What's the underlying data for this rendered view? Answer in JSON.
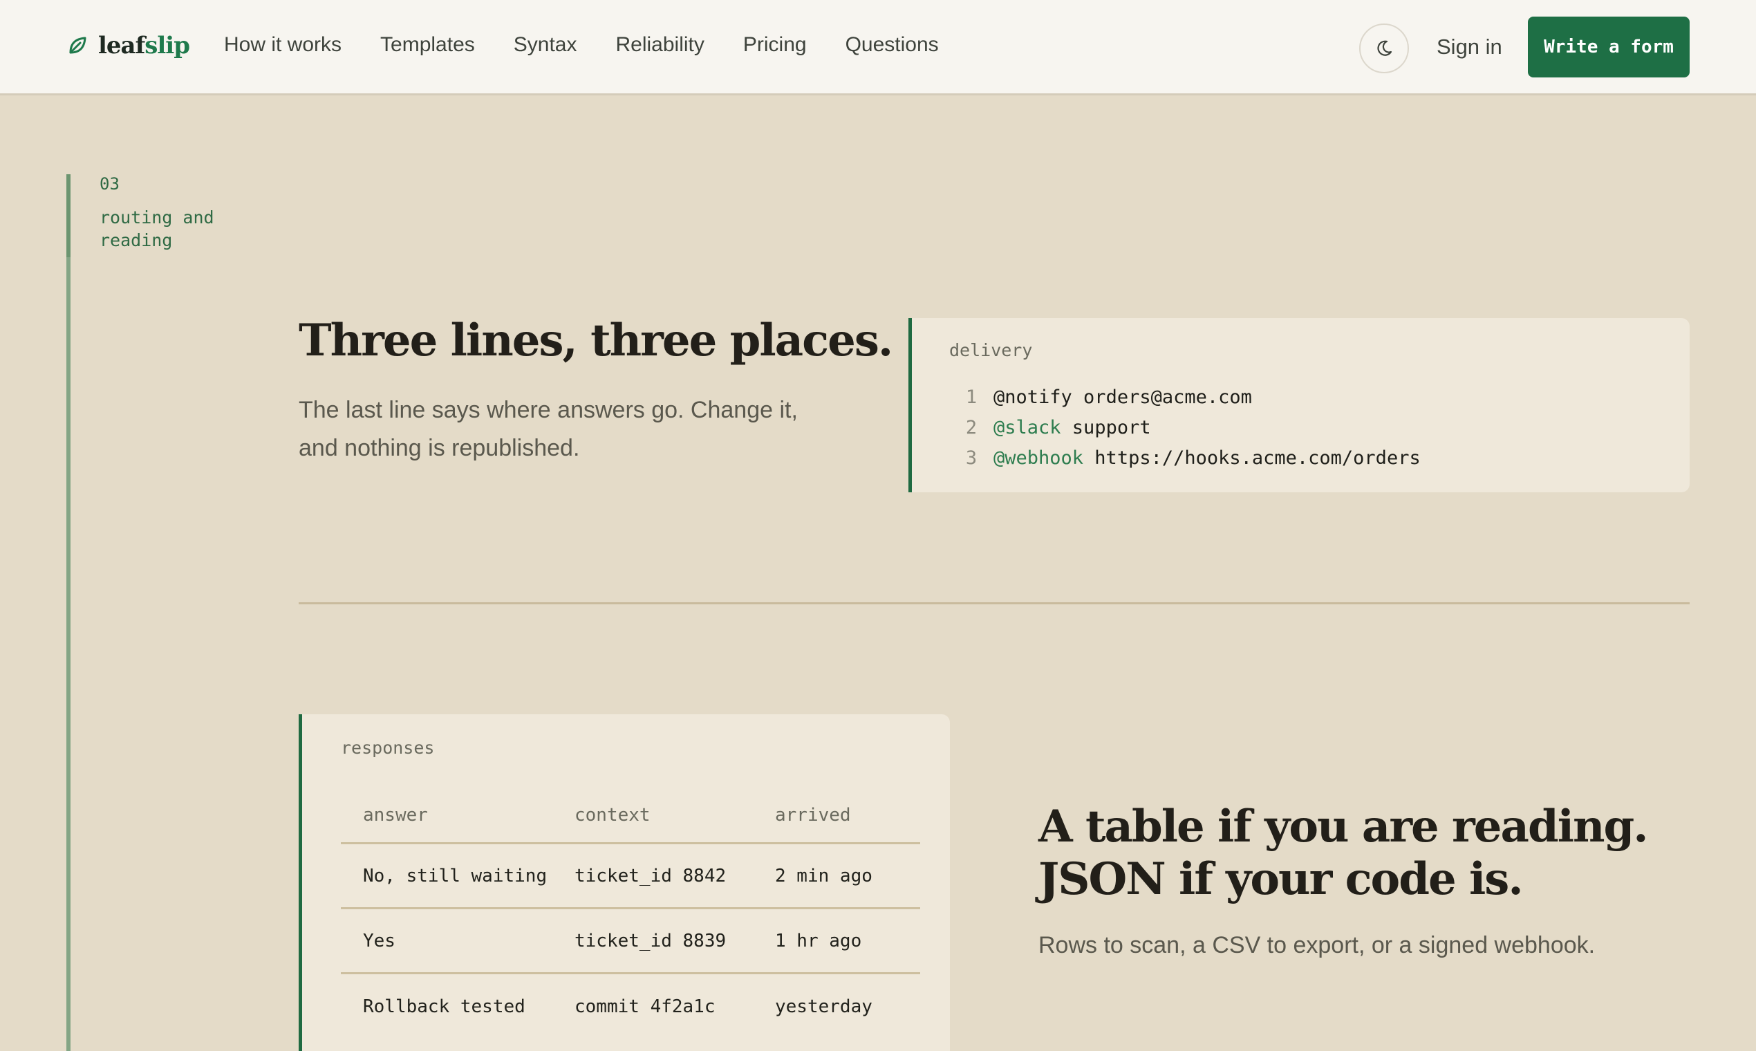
{
  "header": {
    "brand": {
      "part1": "leaf",
      "part2": "slip",
      "icon": "leaf-icon"
    },
    "nav": [
      "How it works",
      "Templates",
      "Syntax",
      "Reliability",
      "Pricing",
      "Questions"
    ],
    "theme_icon": "moon-icon",
    "sign_in": "Sign in",
    "cta": "Write a form"
  },
  "section": {
    "number": "03",
    "label": "routing and reading"
  },
  "delivery": {
    "title": "Three lines, three places.",
    "body": "The last line says where answers go. Change it, and nothing is republished.",
    "code_title": "delivery",
    "lines": [
      {
        "num": "1",
        "directive": "@notify",
        "value": " orders@acme.com",
        "highlight": false
      },
      {
        "num": "2",
        "directive": "@slack",
        "value": " support",
        "highlight": true
      },
      {
        "num": "3",
        "directive": "@webhook",
        "value": " https://hooks.acme.com/orders",
        "highlight": true
      }
    ]
  },
  "responses": {
    "title": "responses",
    "columns": [
      "answer",
      "context",
      "arrived"
    ],
    "rows": [
      [
        "No, still waiting",
        "ticket_id 8842",
        "2 min ago"
      ],
      [
        "Yes",
        "ticket_id 8839",
        "1 hr ago"
      ],
      [
        "Rollback tested",
        "commit 4f2a1c",
        "yesterday"
      ]
    ]
  },
  "reading": {
    "title_line1": "A table if you are reading.",
    "title_line2": "JSON if your code is.",
    "body": "Rows to scan, a CSV to export, or a signed webhook."
  },
  "colors": {
    "accent": "#1e6f45",
    "background": "#e4dbc8",
    "card": "#efe8da",
    "header": "#f7f5f0"
  }
}
